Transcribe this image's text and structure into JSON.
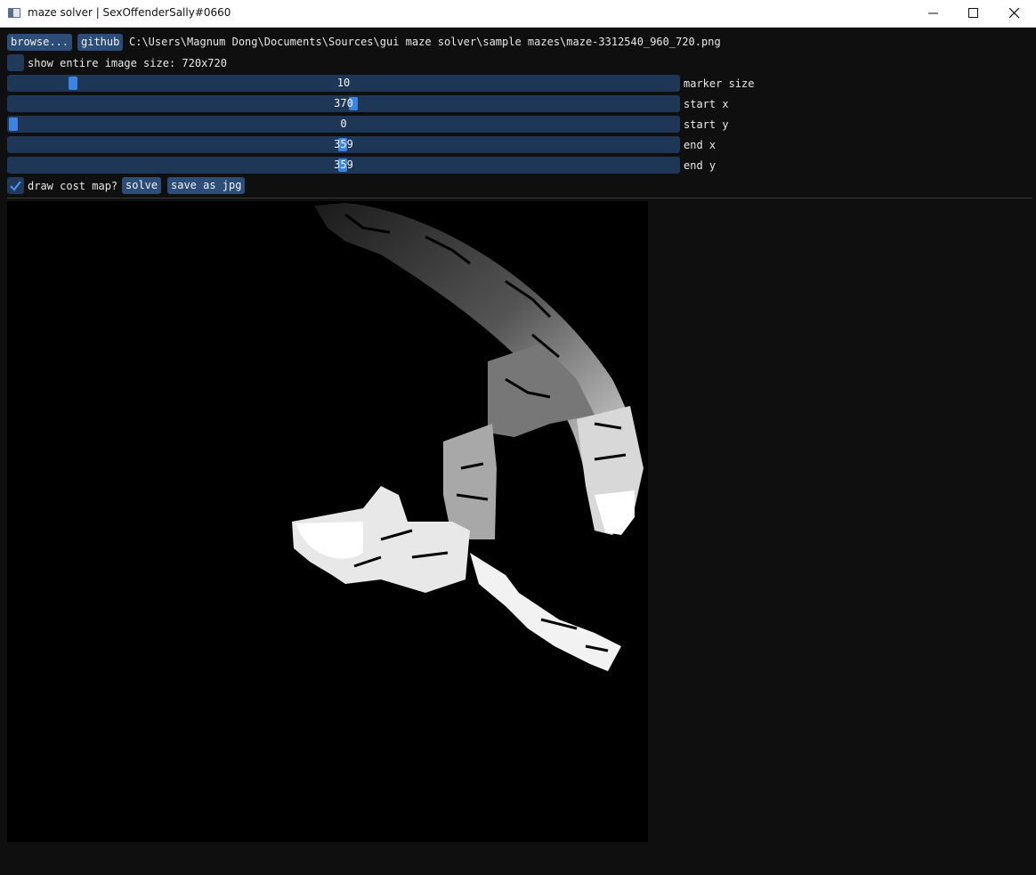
{
  "window": {
    "title": "maze solver | SexOffenderSally#0660",
    "minimize_label": "—",
    "close_label": "✕"
  },
  "toolbar": {
    "browse_label": "browse...",
    "github_label": "github",
    "file_path": "C:\\Users\\Magnum Dong\\Documents\\Sources\\gui maze solver\\sample mazes\\maze-3312540_960_720.png"
  },
  "show_entire": {
    "label": "show entire image size: 720x720",
    "checked": false
  },
  "sliders": [
    {
      "label": "marker size",
      "value": "10",
      "fraction": 0.097
    },
    {
      "label": "start x",
      "value": "370",
      "fraction": 0.514
    },
    {
      "label": "start y",
      "value": "0",
      "fraction": 0.0
    },
    {
      "label": "end x",
      "value": "359",
      "fraction": 0.499
    },
    {
      "label": "end y",
      "value": "359",
      "fraction": 0.499
    }
  ],
  "cost_map": {
    "label": "draw cost map?",
    "checked": true
  },
  "actions": {
    "solve_label": "solve",
    "save_label": "save as jpg"
  },
  "colors": {
    "accent": "#3d84e0",
    "button_bg": "#2b4d78",
    "slider_bg": "#1f3756",
    "background": "#0f0f0f"
  }
}
